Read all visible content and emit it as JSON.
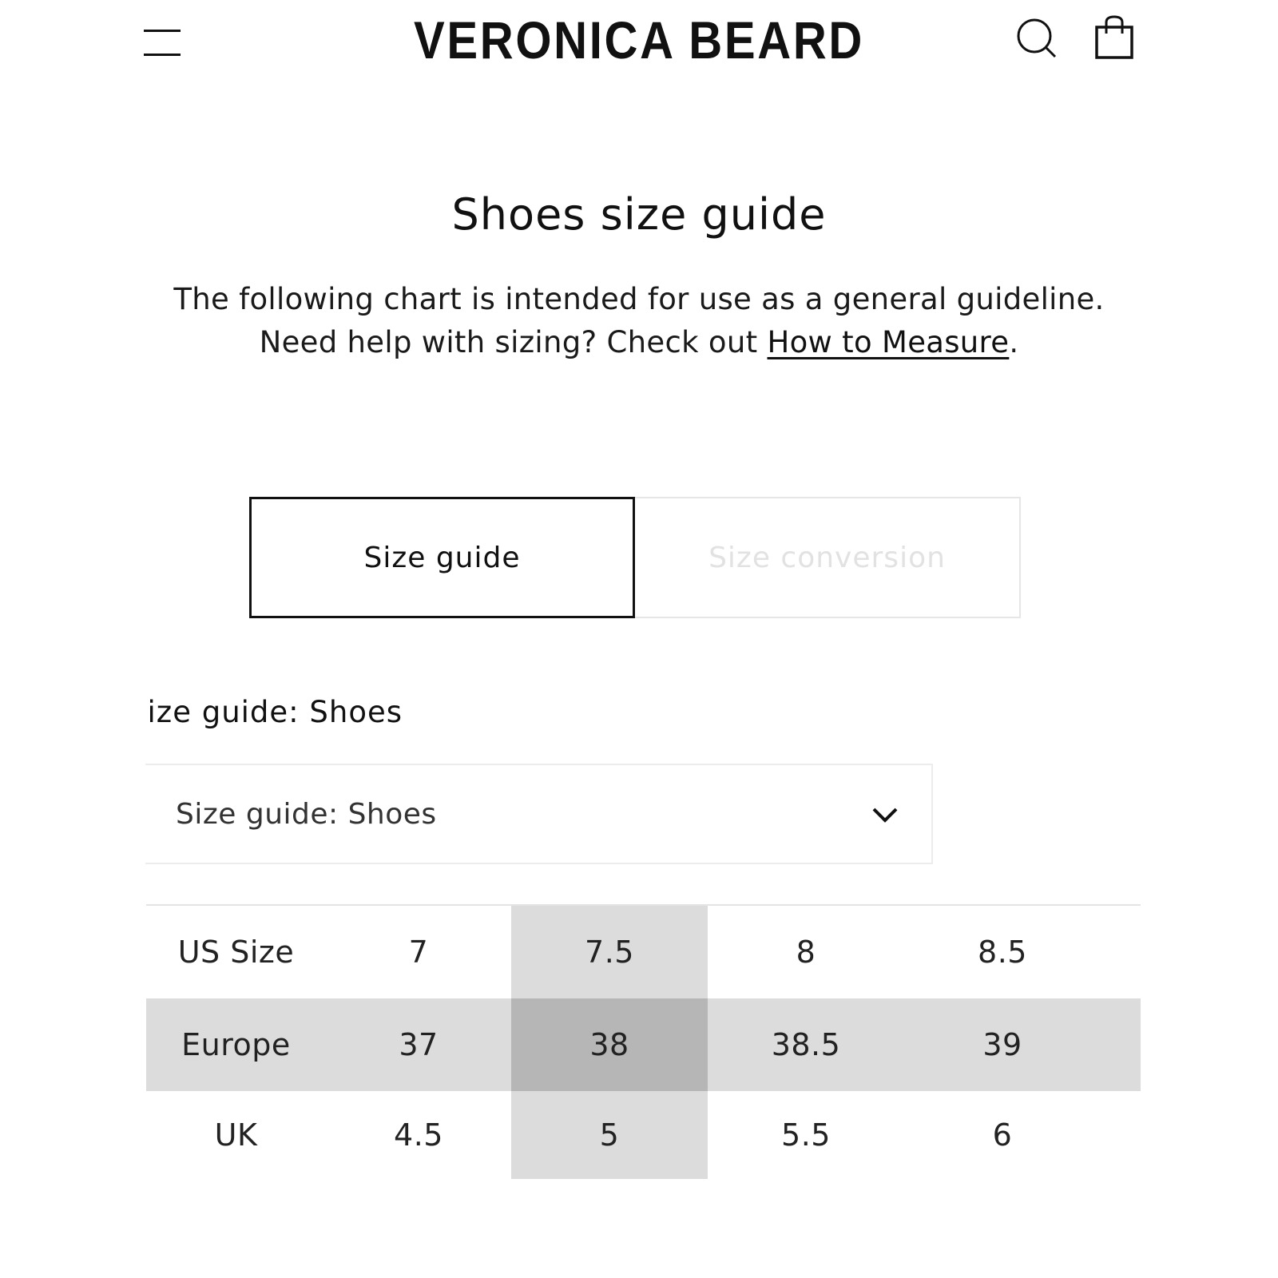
{
  "header": {
    "brand": "VERONICA BEARD",
    "menu_icon": "hamburger-menu-icon",
    "search_icon": "search-icon",
    "bag_icon": "shopping-bag-icon"
  },
  "page": {
    "title": "Shoes size guide",
    "intro_text": "The following chart is intended for use as a general guideline. Need help with sizing? Check out ",
    "intro_link": "How to Measure",
    "intro_end": "."
  },
  "tabs": [
    {
      "label": "Size guide",
      "active": true
    },
    {
      "label": "Size conversion",
      "active": false
    }
  ],
  "section": {
    "title": "Size guide: Shoes"
  },
  "select": {
    "value": "Size guide: Shoes",
    "icon": "chevron-down-icon"
  },
  "table": {
    "highlight_column": 1,
    "rows": [
      {
        "label": "US Size",
        "values": [
          "7",
          "7.5",
          "8",
          "8.5"
        ]
      },
      {
        "label": "Europe",
        "values": [
          "37",
          "38",
          "38.5",
          "39"
        ]
      },
      {
        "label": "UK",
        "values": [
          "4.5",
          "5",
          "5.5",
          "6"
        ]
      }
    ]
  },
  "colors": {
    "text": "#111111",
    "highlight": "#dcdcdc",
    "highlight_intersection": "#b6b6b6",
    "inactive_tab_text": "#e2e2e2"
  }
}
